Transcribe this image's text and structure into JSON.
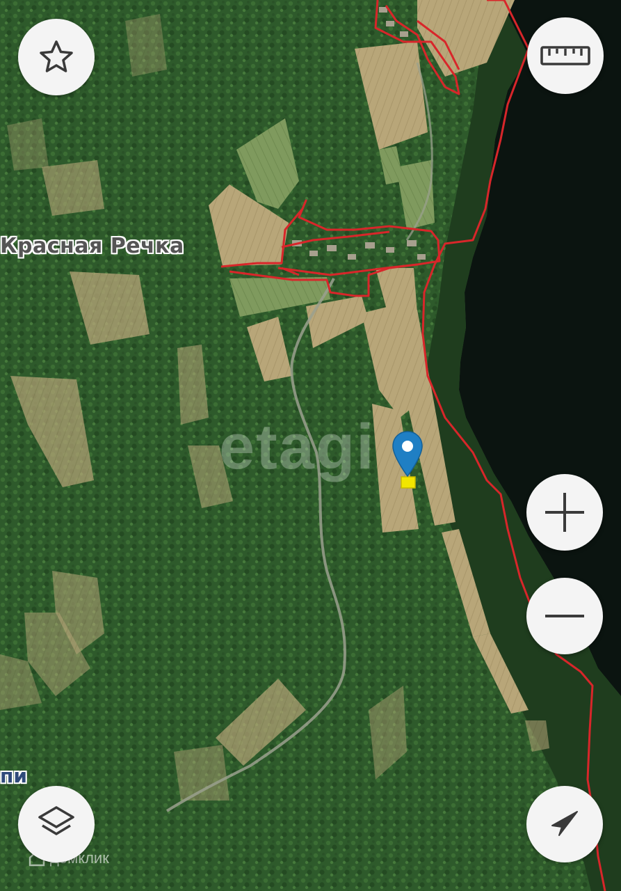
{
  "map": {
    "type": "satellite",
    "place_label": "Красная Речка",
    "partial_label": "пи",
    "watermark": "etagi",
    "brand": "домклик",
    "boundary_color": "#d8262a",
    "marker_color": "#1f7fc4",
    "plot_highlight_color": "#f2e600"
  },
  "controls": {
    "favorite": "star-icon",
    "ruler": "ruler-icon",
    "zoom_in": "plus-icon",
    "zoom_out": "minus-icon",
    "layers": "layers-icon",
    "locate": "navigation-arrow-icon"
  }
}
